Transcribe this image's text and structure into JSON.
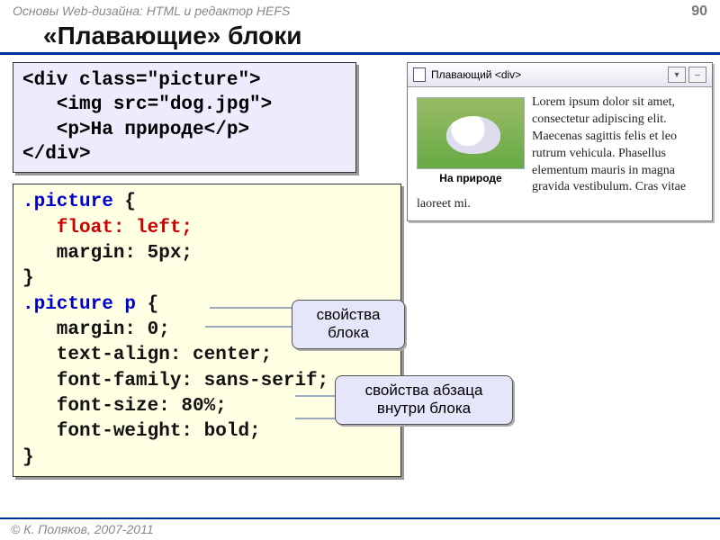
{
  "header": {
    "subject": "Основы Web-дизайна: HTML и редактор HEFS",
    "page": "90"
  },
  "title": "«Плавающие» блоки",
  "html_code": "<div class=\"picture\">\n   <img src=\"dog.jpg\">\n   <p>На природе</p>\n</div>",
  "css_code": {
    "sel1": ".picture",
    "brace_open": " {",
    "float_line": "   float: left;",
    "margin_line": "   margin: 5px;",
    "brace_close": "}",
    "sel2": ".picture p",
    "p_lines": "   margin: 0;\n   text-align: center;\n   font-family: sans-serif;\n   font-size: 80%;\n   font-weight: bold;\n}"
  },
  "browser": {
    "title": "Плавающий <div>",
    "caption": "На природе",
    "lorem": "Lorem ipsum dolor sit amet, consectetur adipiscing elit. Maecenas sagittis felis et leo rutrum vehicula. Phasellus elementum mauris in magna gravida vestibulum. Cras vitae laoreet mi."
  },
  "callouts": {
    "block": "свойства блока",
    "para": "свойства абзаца внутри блока"
  },
  "footer": "© К. Поляков, 2007-2011"
}
